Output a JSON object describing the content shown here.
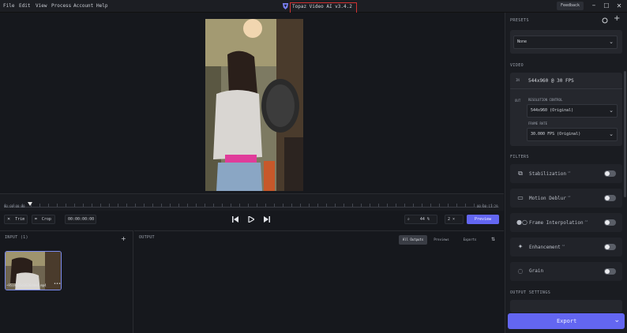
{
  "menu": [
    "File",
    "Edit",
    "View",
    "Process",
    "Account",
    "Help"
  ],
  "app": {
    "title": "Topaz Video AI  v3.4.2"
  },
  "titlebar": {
    "feedback_label": "Feedback",
    "minimize": "–",
    "maximize": "☐",
    "close": "✕"
  },
  "timeline": {
    "start_time": "00:00:00:00",
    "end_time": "00:00:11:29"
  },
  "controls": {
    "trim_label": "Trim",
    "crop_label": "Crop",
    "timecode": "00:00:00:00",
    "zoom_value": "44 %",
    "speed_value": "2 ×",
    "preview_label": "Preview"
  },
  "input": {
    "title": "INPUT (1)",
    "add": "+",
    "file_name": "~9519135d3026d4ed.mp4",
    "more": "•••"
  },
  "output": {
    "title": "OUTPUT",
    "tabs": [
      "All Outputs",
      "Previews",
      "Exports"
    ],
    "sort": "⇅"
  },
  "presets": {
    "title": "PRESETS",
    "value": "None"
  },
  "video": {
    "title": "VIDEO",
    "in_badge": "IN",
    "in_value": "544x960 @ 30 FPS",
    "out_badge": "OUT",
    "resolution_label": "RESOLUTION CONTROL",
    "resolution_value": "544x960 (Original)",
    "framerate_label": "FRAME RATE",
    "framerate_value": "30.000 FPS (Original)"
  },
  "filters": {
    "title": "FILTERS",
    "items": [
      {
        "label": "Stabilization",
        "sup": "AI",
        "icon": "stabilization-icon"
      },
      {
        "label": "Motion Deblur",
        "sup": "AI",
        "icon": "motion-deblur-icon"
      },
      {
        "label": "Frame Interpolation",
        "sup": "AI",
        "icon": "frame-interpolation-icon"
      },
      {
        "label": "Enhancement",
        "sup": "AI",
        "icon": "enhancement-icon"
      },
      {
        "label": "Grain",
        "sup": "",
        "icon": "grain-icon"
      }
    ]
  },
  "output_settings": {
    "title": "OUTPUT SETTINGS"
  },
  "export": {
    "label": "Export"
  },
  "colors": {
    "accent": "#6366f1",
    "highlight_box": "#d03232"
  }
}
